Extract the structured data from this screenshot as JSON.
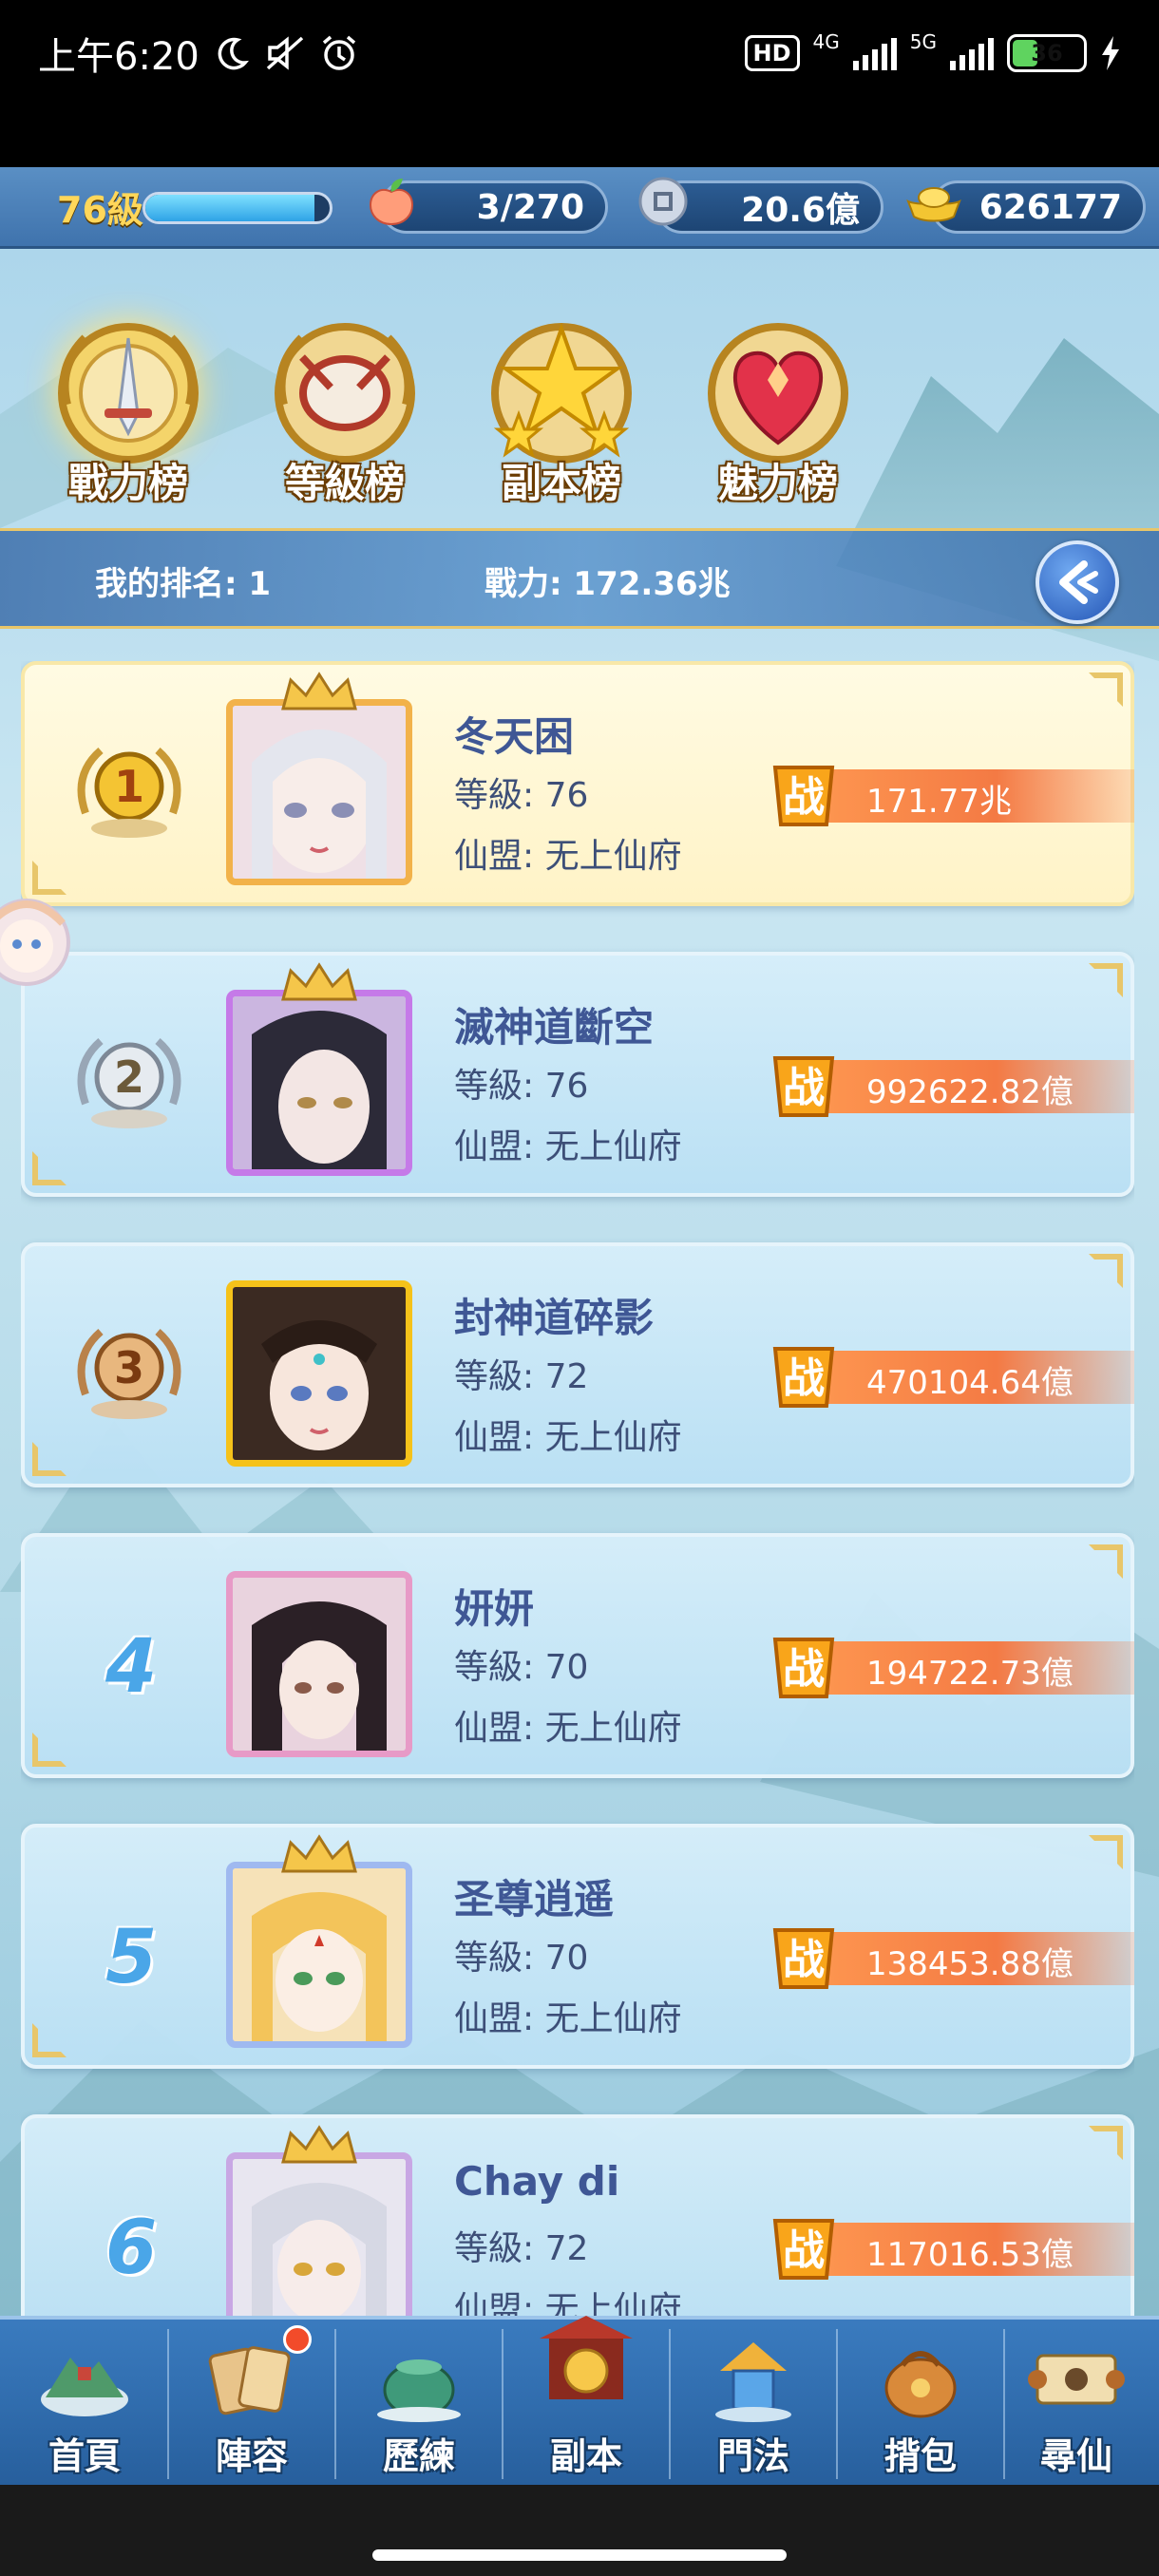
{
  "status_bar": {
    "time": "上午6:20",
    "hd_label": "HD",
    "net_4g": "4G",
    "net_5g": "5G",
    "battery": "36",
    "battery_level": 0.36
  },
  "top_bar": {
    "level": "76級",
    "xp_progress": 0.92,
    "stamina": "3/270",
    "silver": "20.6億",
    "gold": "626177"
  },
  "tabs": [
    {
      "label": "戰力榜",
      "active": true
    },
    {
      "label": "等級榜",
      "active": false
    },
    {
      "label": "副本榜",
      "active": false
    },
    {
      "label": "魅力榜",
      "active": false
    }
  ],
  "my_rank": {
    "rank_text": "我的排名: 1",
    "power_text": "戰力: 172.36兆"
  },
  "power_badge_char": "战",
  "entries": [
    {
      "rank": "1",
      "name": "冬天困",
      "level": "等級: 76",
      "guild": "仙盟: 无上仙府",
      "power": "171.77兆"
    },
    {
      "rank": "2",
      "name": "滅神道斷空",
      "level": "等級: 76",
      "guild": "仙盟: 无上仙府",
      "power": "992622.82億"
    },
    {
      "rank": "3",
      "name": "封神道碎影",
      "level": "等級: 72",
      "guild": "仙盟: 无上仙府",
      "power": "470104.64億"
    },
    {
      "rank": "4",
      "name": "妍妍",
      "level": "等級: 70",
      "guild": "仙盟: 无上仙府",
      "power": "194722.73億"
    },
    {
      "rank": "5",
      "name": "圣尊逍遥",
      "level": "等級: 70",
      "guild": "仙盟: 无上仙府",
      "power": "138453.88億"
    },
    {
      "rank": "6",
      "name": "Chay di",
      "level": "等級: 72",
      "guild": "仙盟: 无上仙府",
      "power": "117016.53億"
    }
  ],
  "bottom_nav": [
    {
      "label": "首頁",
      "icon": "home-island-icon"
    },
    {
      "label": "陣容",
      "icon": "lineup-cards-icon",
      "badge": true
    },
    {
      "label": "歷練",
      "icon": "training-pot-icon"
    },
    {
      "label": "副本",
      "icon": "dungeon-gate-icon"
    },
    {
      "label": "門法",
      "icon": "sect-tower-icon"
    },
    {
      "label": "揹包",
      "icon": "backpack-icon"
    },
    {
      "label": "尋仙",
      "icon": "scroll-search-icon"
    }
  ]
}
